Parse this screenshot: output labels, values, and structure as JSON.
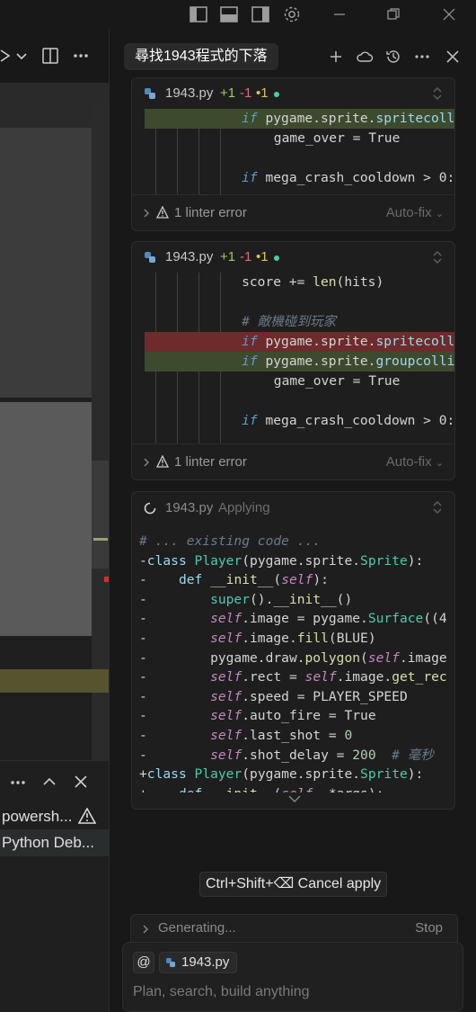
{
  "topbar": {
    "icons": [
      "toggle-primary-sidebar-icon",
      "toggle-panel-icon",
      "toggle-secondary-sidebar-icon",
      "settings-gear-icon",
      "minimize-icon",
      "restore-icon",
      "close-window-icon"
    ]
  },
  "left_pane": {
    "toolbar_icons": [
      "run-icon",
      "chevron-down-icon",
      "split-editor-icon",
      "more-icon"
    ],
    "panel_icons": [
      "more-icon",
      "chevron-up-icon",
      "close-icon"
    ],
    "terminals": [
      {
        "label": "powersh...",
        "warning": true
      },
      {
        "label": "Python Deb..."
      }
    ]
  },
  "chat": {
    "title": "尋找1943程式的下落",
    "header_icons": [
      "new-chat-icon",
      "cloud-icon",
      "history-icon",
      "more-icon",
      "close-icon"
    ],
    "cards": [
      {
        "file": "1943.py",
        "added": "+1",
        "removed": "-1",
        "modified": "•1",
        "linter": "1 linter error",
        "autofix": "Auto-fix",
        "lines": [
          {
            "hl": "green",
            "indent": 3,
            "tokens": [
              {
                "t": "if",
                "c": "kw"
              },
              {
                "t": " pygame.sprite.",
                "c": "sel"
              },
              {
                "t": "spritecoll",
                "c": "kwc"
              }
            ]
          },
          {
            "hl": "",
            "indent": 4,
            "tokens": [
              {
                "t": "game_over = True",
                "c": "lit"
              }
            ]
          },
          {
            "hl": "",
            "indent": 0,
            "tokens": []
          },
          {
            "hl": "",
            "indent": 3,
            "tokens": [
              {
                "t": "if",
                "c": "kw"
              },
              {
                "t": " mega_crash_cooldown > 0:",
                "c": "lit"
              }
            ]
          }
        ]
      },
      {
        "file": "1943.py",
        "added": "+1",
        "removed": "-1",
        "modified": "•1",
        "linter": "1 linter error",
        "autofix": "Auto-fix",
        "lines": [
          {
            "hl": "",
            "indent": 3,
            "tokens": [
              {
                "t": "score += ",
                "c": "lit"
              },
              {
                "t": "len",
                "c": "fn"
              },
              {
                "t": "(hits)",
                "c": "lit"
              }
            ]
          },
          {
            "hl": "",
            "indent": 0,
            "tokens": []
          },
          {
            "hl": "",
            "indent": 3,
            "tokens": [
              {
                "t": "# 敵機碰到玩家",
                "c": "cmt"
              }
            ]
          },
          {
            "hl": "red",
            "indent": 3,
            "tokens": [
              {
                "t": "if",
                "c": "kw"
              },
              {
                "t": " pygame.sprite.",
                "c": "sel"
              },
              {
                "t": "spritecoll",
                "c": "kwc"
              }
            ]
          },
          {
            "hl": "green",
            "indent": 3,
            "tokens": [
              {
                "t": "if",
                "c": "kw"
              },
              {
                "t": " pygame.sprite.",
                "c": "sel"
              },
              {
                "t": "groupcolli",
                "c": "kwc"
              }
            ]
          },
          {
            "hl": "",
            "indent": 4,
            "tokens": [
              {
                "t": "game_over = True",
                "c": "lit"
              }
            ]
          },
          {
            "hl": "",
            "indent": 0,
            "tokens": []
          },
          {
            "hl": "",
            "indent": 3,
            "tokens": [
              {
                "t": "if",
                "c": "kw"
              },
              {
                "t": " mega_crash_cooldown > 0:",
                "c": "lit"
              }
            ]
          }
        ]
      }
    ],
    "applying": {
      "file": "1943.py",
      "status": "Applying",
      "lines": [
        [
          {
            "t": "# ... existing code ...",
            "c": "cmt"
          }
        ],
        [
          {
            "t": "-",
            "c": "lit"
          },
          {
            "t": "class",
            "c": "kwc"
          },
          {
            "t": " ",
            "c": "lit"
          },
          {
            "t": "Player",
            "c": "cls"
          },
          {
            "t": "(pygame.sprite.",
            "c": "lit"
          },
          {
            "t": "Sprite",
            "c": "cls"
          },
          {
            "t": "):",
            "c": "lit"
          }
        ],
        [
          {
            "t": "-    ",
            "c": "lit"
          },
          {
            "t": "def",
            "c": "kwc"
          },
          {
            "t": " ",
            "c": "lit"
          },
          {
            "t": "__init__",
            "c": "fn"
          },
          {
            "t": "(",
            "c": "lit"
          },
          {
            "t": "self",
            "c": "slf"
          },
          {
            "t": "):",
            "c": "lit"
          }
        ],
        [
          {
            "t": "-        ",
            "c": "lit"
          },
          {
            "t": "super",
            "c": "cls"
          },
          {
            "t": "().",
            "c": "lit"
          },
          {
            "t": "__init__",
            "c": "fn"
          },
          {
            "t": "()",
            "c": "lit"
          }
        ],
        [
          {
            "t": "-        ",
            "c": "lit"
          },
          {
            "t": "self",
            "c": "slf"
          },
          {
            "t": ".image = pygame.",
            "c": "lit"
          },
          {
            "t": "Surface",
            "c": "cls"
          },
          {
            "t": "((4",
            "c": "lit"
          }
        ],
        [
          {
            "t": "-        ",
            "c": "lit"
          },
          {
            "t": "self",
            "c": "slf"
          },
          {
            "t": ".image.",
            "c": "lit"
          },
          {
            "t": "fill",
            "c": "fn"
          },
          {
            "t": "(BLUE)",
            "c": "lit"
          }
        ],
        [
          {
            "t": "-        ",
            "c": "lit"
          },
          {
            "t": "pygame.draw.",
            "c": "lit"
          },
          {
            "t": "polygon",
            "c": "fn"
          },
          {
            "t": "(",
            "c": "lit"
          },
          {
            "t": "self",
            "c": "slf"
          },
          {
            "t": ".image",
            "c": "lit"
          }
        ],
        [
          {
            "t": "-        ",
            "c": "lit"
          },
          {
            "t": "self",
            "c": "slf"
          },
          {
            "t": ".rect = ",
            "c": "lit"
          },
          {
            "t": "self",
            "c": "slf"
          },
          {
            "t": ".image.",
            "c": "lit"
          },
          {
            "t": "get_rec",
            "c": "fn"
          }
        ],
        [
          {
            "t": "-        ",
            "c": "lit"
          },
          {
            "t": "self",
            "c": "slf"
          },
          {
            "t": ".speed = PLAYER_SPEED",
            "c": "lit"
          }
        ],
        [
          {
            "t": "-        ",
            "c": "lit"
          },
          {
            "t": "self",
            "c": "slf"
          },
          {
            "t": ".auto_fire = True",
            "c": "lit"
          }
        ],
        [
          {
            "t": "-        ",
            "c": "lit"
          },
          {
            "t": "self",
            "c": "slf"
          },
          {
            "t": ".last_shot = ",
            "c": "lit"
          },
          {
            "t": "0",
            "c": "num"
          }
        ],
        [
          {
            "t": "-        ",
            "c": "lit"
          },
          {
            "t": "self",
            "c": "slf"
          },
          {
            "t": ".shot_delay = ",
            "c": "lit"
          },
          {
            "t": "200",
            "c": "num"
          },
          {
            "t": "  # 毫秒",
            "c": "cmt"
          }
        ],
        [
          {
            "t": "+",
            "c": "lit"
          },
          {
            "t": "class",
            "c": "kwc"
          },
          {
            "t": " ",
            "c": "lit"
          },
          {
            "t": "Player",
            "c": "cls"
          },
          {
            "t": "(pygame.sprite.",
            "c": "lit"
          },
          {
            "t": "Sprite",
            "c": "cls"
          },
          {
            "t": "):",
            "c": "lit"
          }
        ],
        [
          {
            "t": "+    ",
            "c": "lit"
          },
          {
            "t": "def",
            "c": "kwc"
          },
          {
            "t": " ",
            "c": "lit"
          },
          {
            "t": "__init__",
            "c": "fn"
          },
          {
            "t": "(",
            "c": "lit"
          },
          {
            "t": "self",
            "c": "slf"
          },
          {
            "t": ", *args):",
            "c": "lit"
          }
        ]
      ]
    },
    "cancel_apply": "Ctrl+Shift+⌫ Cancel apply",
    "generating": "Generating...",
    "stop": "Stop",
    "mention_symbol": "@",
    "context_file": "1943.py",
    "input_placeholder": "Plan, search, build anything"
  }
}
